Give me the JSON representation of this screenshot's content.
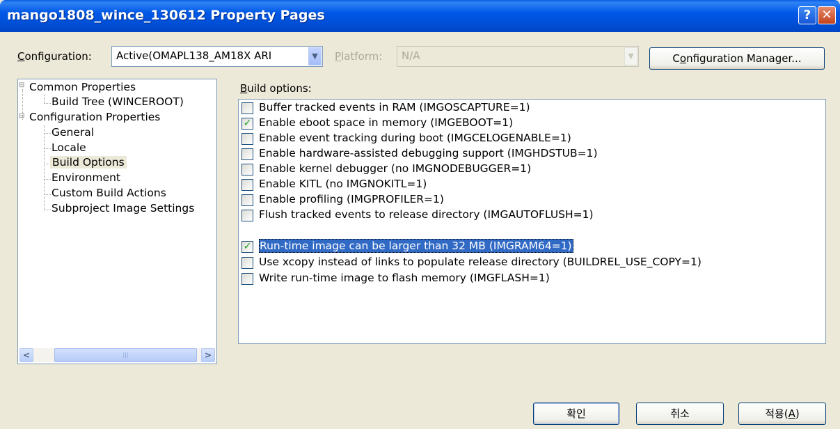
{
  "window": {
    "title": "mango1808_wince_130612 Property Pages",
    "help_glyph": "?",
    "close_glyph": "✕"
  },
  "config": {
    "label_accel": "C",
    "label_rest": "onfiguration:",
    "value": "Active(OMAPL138_AM18X ARI",
    "platform_label_accel": "P",
    "platform_label_rest": "latform:",
    "platform_value": "N/A",
    "manager_button_accel": "o",
    "manager_button_pre": "C",
    "manager_button_rest": "nfiguration Manager..."
  },
  "tree": {
    "items": [
      {
        "label": "Common Properties",
        "expander": "⊟"
      },
      {
        "label": "Build Tree (WINCEROOT)"
      },
      {
        "label": "Configuration Properties",
        "expander": "⊟"
      },
      {
        "label": "General"
      },
      {
        "label": "Locale"
      },
      {
        "label": "Build Options"
      },
      {
        "label": "Environment"
      },
      {
        "label": "Custom Build Actions"
      },
      {
        "label": "Subproject Image Settings"
      }
    ]
  },
  "build_options": {
    "label_accel": "B",
    "label_rest": "uild options:",
    "options": [
      {
        "label": "Buffer tracked events in RAM (IMGOSCAPTURE=1)",
        "checked": false
      },
      {
        "label": "Enable eboot space in memory (IMGEBOOT=1)",
        "checked": true
      },
      {
        "label": "Enable event tracking during boot (IMGCELOGENABLE=1)",
        "checked": false
      },
      {
        "label": "Enable hardware-assisted debugging support (IMGHDSTUB=1)",
        "checked": false
      },
      {
        "label": "Enable kernel debugger (no IMGNODEBUGGER=1)",
        "checked": false
      },
      {
        "label": "Enable KITL (no IMGNOKITL=1)",
        "checked": false
      },
      {
        "label": "Enable profiling (IMGPROFILER=1)",
        "checked": false
      },
      {
        "label": "Flush tracked events to release directory (IMGAUTOFLUSH=1)",
        "checked": false
      },
      {
        "label": "Run-time image can be larger than 32 MB (IMGRAM64=1)",
        "checked": true
      },
      {
        "label": "Use xcopy instead of links to populate release directory (BUILDREL_USE_COPY=1)",
        "checked": false
      },
      {
        "label": "Write run-time image to flash memory (IMGFLASH=1)",
        "checked": false
      }
    ],
    "check_glyph": "✓"
  },
  "buttons": {
    "ok": "확인",
    "cancel": "취소",
    "apply_pre": "적용(",
    "apply_accel": "A",
    "apply_post": ")"
  },
  "scroll": {
    "left_glyph": "<",
    "right_glyph": ">",
    "thumb_grip": "|||"
  }
}
